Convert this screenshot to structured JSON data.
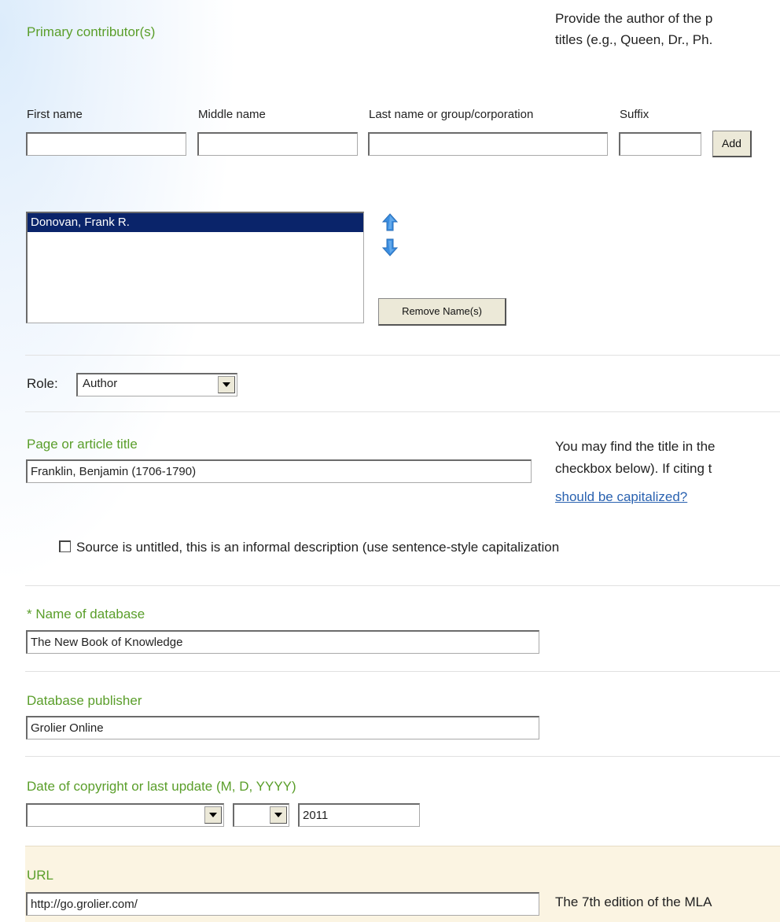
{
  "contributors": {
    "heading": "Primary contributor(s)",
    "help_line1": "Provide the author of the p",
    "help_line2": "titles (e.g., Queen, Dr., Ph.",
    "first_label": "First name",
    "middle_label": "Middle name",
    "last_label": "Last name or group/corporation",
    "suffix_label": "Suffix",
    "first_value": "",
    "middle_value": "",
    "last_value": "",
    "suffix_value": "",
    "add_button": "Add",
    "names_list": [
      "Donovan, Frank R."
    ],
    "remove_button": "Remove Name(s)",
    "move_up_icon": "arrow-up-icon",
    "move_down_icon": "arrow-down-icon"
  },
  "role": {
    "label": "Role:",
    "selected": "Author"
  },
  "title_section": {
    "label": "Page or article title",
    "value": "Franklin, Benjamin (1706-1790)",
    "help_line1": "You may find the title in the",
    "help_line2": "checkbox below). If citing t",
    "help_link": "should be capitalized?",
    "untitled_checkbox_label": "Source is untitled, this is an informal description (use sentence-style capitalization",
    "untitled_checked": false
  },
  "database": {
    "label": "* Name of database",
    "value": "The New Book of Knowledge"
  },
  "publisher": {
    "label": "Database publisher",
    "value": "Grolier Online"
  },
  "date": {
    "label": "Date of copyright or last update (M, D, YYYY)",
    "month": "",
    "day": "",
    "year": "2011"
  },
  "url": {
    "label": "URL",
    "value": "http://go.grolier.com/",
    "help": "The 7th edition of the MLA"
  },
  "colors": {
    "label_green": "#5a9e2a",
    "selected_row": "#0a246a",
    "url_section_bg": "#fbf4e2",
    "link_blue": "#2a62b0",
    "arrow_blue": "#3a8de0"
  }
}
